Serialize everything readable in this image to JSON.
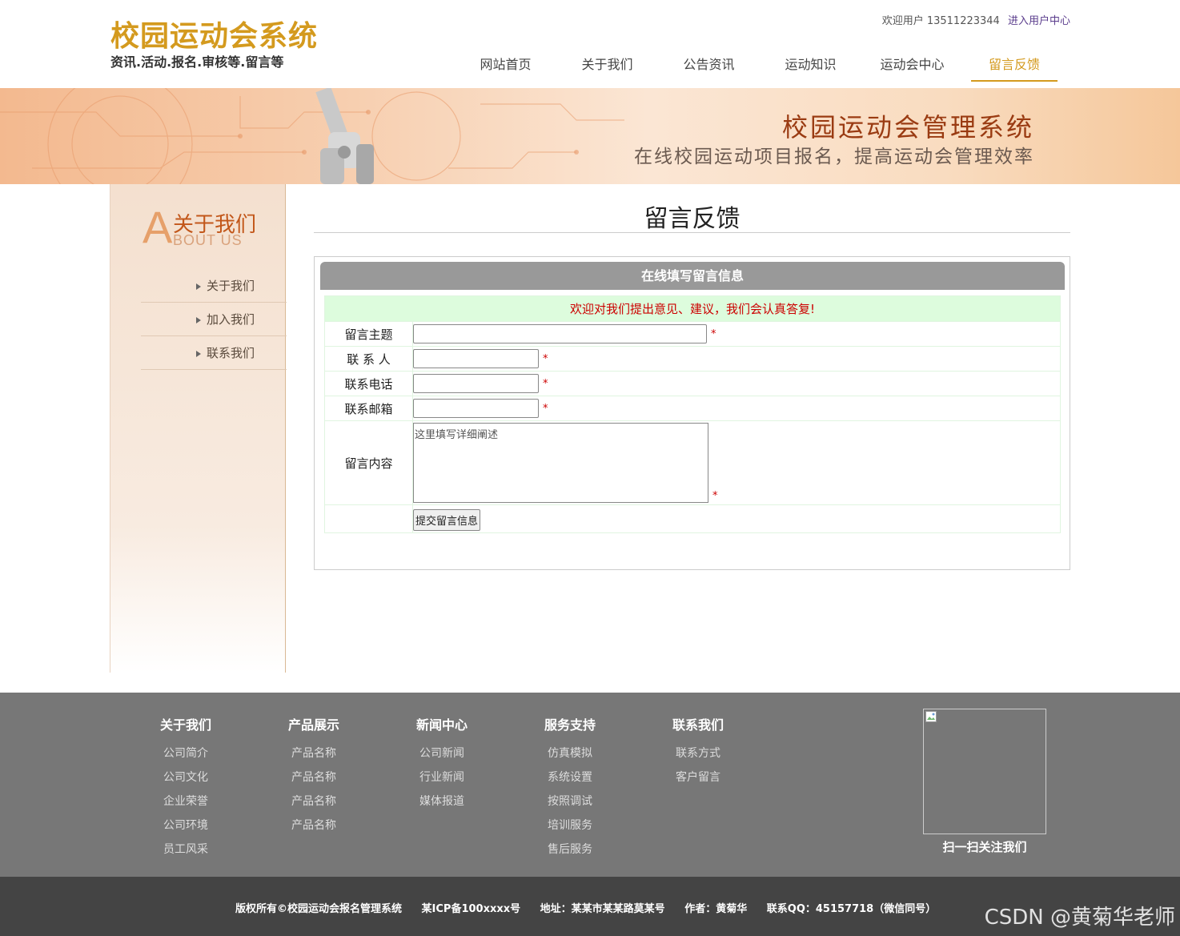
{
  "header": {
    "logo_title": "校园运动会系统",
    "logo_sub": "资讯.活动.报名.审核等.留言等",
    "welcome_text": "欢迎用户 13511223344",
    "user_center_link": "进入用户中心"
  },
  "nav": {
    "items": [
      "网站首页",
      "关于我们",
      "公告资讯",
      "运动知识",
      "运动会中心",
      "留言反馈"
    ],
    "active": "留言反馈"
  },
  "banner": {
    "title": "校园运动会管理系统",
    "subtitle": "在线校园运动项目报名，提高运动会管理效率"
  },
  "sidebar": {
    "head_letter": "A",
    "head_cn": "关于我们",
    "head_en": "BOUT US",
    "items": [
      "关于我们",
      "加入我们",
      "联系我们"
    ]
  },
  "main": {
    "page_title": "留言反馈",
    "form_header": "在线填写留言信息",
    "welcome_msg": "欢迎对我们提出意见、建议，我们会认真答复!",
    "labels": {
      "subject": "留言主题",
      "contact": "联 系 人",
      "phone": "联系电话",
      "email": "联系邮箱",
      "content": "留言内容"
    },
    "required_mark": "*",
    "content_placeholder": "这里填写详细阐述",
    "submit_label": "提交留言信息"
  },
  "footer": {
    "columns": [
      {
        "title": "关于我们",
        "links": [
          "公司简介",
          "公司文化",
          "企业荣誉",
          "公司环境",
          "员工风采"
        ]
      },
      {
        "title": "产品展示",
        "links": [
          "产品名称",
          "产品名称",
          "产品名称",
          "产品名称"
        ]
      },
      {
        "title": "新闻中心",
        "links": [
          "公司新闻",
          "行业新闻",
          "媒体报道"
        ]
      },
      {
        "title": "服务支持",
        "links": [
          "仿真模拟",
          "系统设置",
          "按照调试",
          "培训服务",
          "售后服务"
        ]
      },
      {
        "title": "联系我们",
        "links": [
          "联系方式",
          "客户留言"
        ]
      }
    ],
    "qr_caption": "扫一扫关注我们"
  },
  "bottom": {
    "copyright": "版权所有©校园运动会报名管理系统",
    "icp": "某ICP备100xxxx号",
    "address": "地址：某某市某某路莫某号",
    "author": "作者：黄菊华",
    "qq": "联系QQ：45157718（微信同号）",
    "watermark": "CSDN @黄菊华老师"
  },
  "colors": {
    "accent": "#d49a1e",
    "banner_title": "#9a3b12",
    "required": "#cc0000",
    "welcome_bg": "#ddfcdd",
    "footer_bg": "#777777",
    "bottom_bg": "#444444"
  }
}
